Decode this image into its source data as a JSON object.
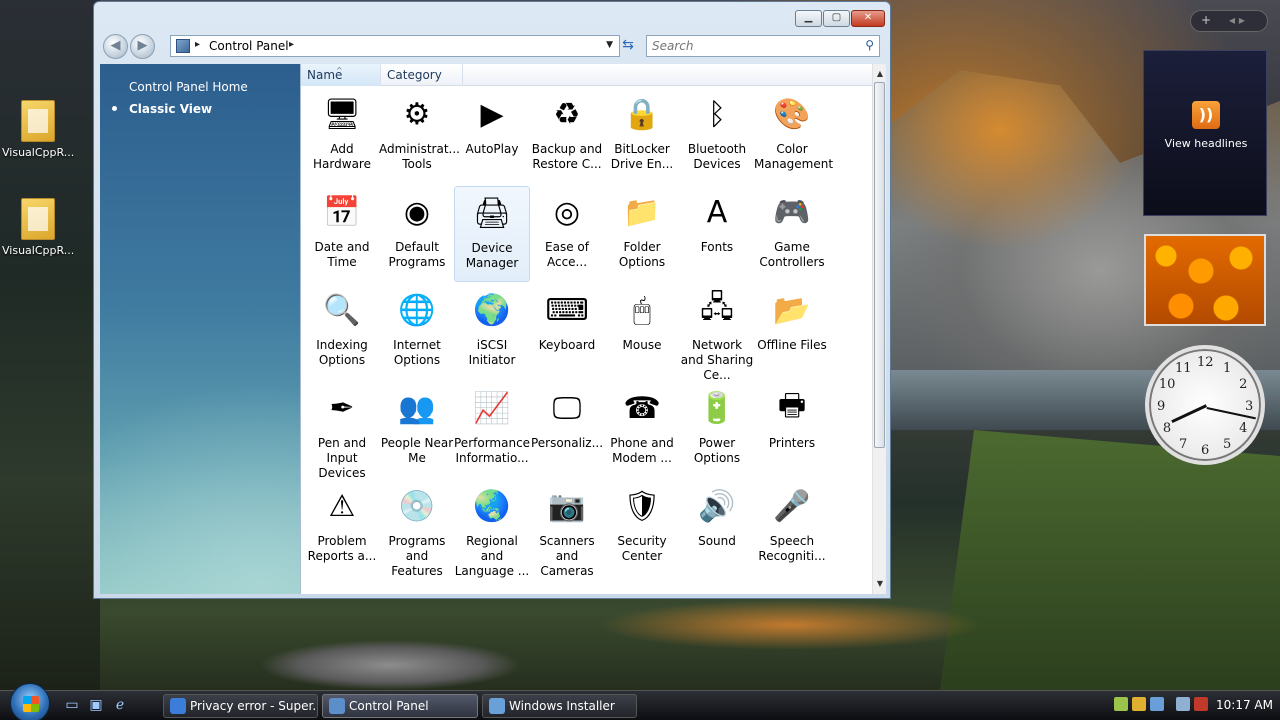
{
  "desktop": {
    "icons": [
      {
        "label": "VisualCppR..."
      },
      {
        "label": "VisualCppR..."
      }
    ]
  },
  "window": {
    "controls": {
      "minimize": "▁",
      "maximize": "▢",
      "close": "✕"
    },
    "address": {
      "path": "Control Panel",
      "separator": "▸"
    },
    "search": {
      "placeholder": "Search"
    },
    "left_pane": {
      "home_link": "Control Panel Home",
      "classic_view": "Classic View"
    },
    "columns": {
      "name": "Name",
      "category": "Category"
    },
    "items": [
      {
        "label": "Add Hardware",
        "icon": "add-hardware-icon",
        "glyph": "🖥"
      },
      {
        "label": "Administrat... Tools",
        "icon": "administrative-tools-icon",
        "glyph": "⚙"
      },
      {
        "label": "AutoPlay",
        "icon": "autoplay-icon",
        "glyph": "▶"
      },
      {
        "label": "Backup and Restore C...",
        "icon": "backup-icon",
        "glyph": "♻"
      },
      {
        "label": "BitLocker Drive En...",
        "icon": "bitlocker-icon",
        "glyph": "🔒"
      },
      {
        "label": "Bluetooth Devices",
        "icon": "bluetooth-icon",
        "glyph": "ᛒ"
      },
      {
        "label": "Color Management",
        "icon": "color-management-icon",
        "glyph": "🎨"
      },
      {
        "label": "Date and Time",
        "icon": "date-time-icon",
        "glyph": "📅"
      },
      {
        "label": "Default Programs",
        "icon": "default-programs-icon",
        "glyph": "◉"
      },
      {
        "label": "Device Manager",
        "icon": "device-manager-icon",
        "glyph": "🖨"
      },
      {
        "label": "Ease of Acce...",
        "icon": "ease-of-access-icon",
        "glyph": "◎"
      },
      {
        "label": "Folder Options",
        "icon": "folder-options-icon",
        "glyph": "📁"
      },
      {
        "label": "Fonts",
        "icon": "fonts-icon",
        "glyph": "A"
      },
      {
        "label": "Game Controllers",
        "icon": "game-controller-icon",
        "glyph": "🎮"
      },
      {
        "label": "Indexing Options",
        "icon": "indexing-icon",
        "glyph": "🔍"
      },
      {
        "label": "Internet Options",
        "icon": "internet-options-icon",
        "glyph": "🌐"
      },
      {
        "label": "iSCSI Initiator",
        "icon": "iscsi-icon",
        "glyph": "🌍"
      },
      {
        "label": "Keyboard",
        "icon": "keyboard-icon",
        "glyph": "⌨"
      },
      {
        "label": "Mouse",
        "icon": "mouse-icon",
        "glyph": "🖱"
      },
      {
        "label": "Network and Sharing Ce...",
        "icon": "network-icon",
        "glyph": "🖧"
      },
      {
        "label": "Offline Files",
        "icon": "offline-files-icon",
        "glyph": "📂"
      },
      {
        "label": "Pen and Input Devices",
        "icon": "pen-icon",
        "glyph": "✒"
      },
      {
        "label": "People Near Me",
        "icon": "people-icon",
        "glyph": "👥"
      },
      {
        "label": "Performance Informatio...",
        "icon": "performance-icon",
        "glyph": "📈"
      },
      {
        "label": "Personaliz...",
        "icon": "personalize-icon",
        "glyph": "🖵"
      },
      {
        "label": "Phone and Modem ...",
        "icon": "phone-icon",
        "glyph": "☎"
      },
      {
        "label": "Power Options",
        "icon": "power-icon",
        "glyph": "🔋"
      },
      {
        "label": "Printers",
        "icon": "printers-icon",
        "glyph": "🖶"
      },
      {
        "label": "Problem Reports a...",
        "icon": "problem-reports-icon",
        "glyph": "⚠"
      },
      {
        "label": "Programs and Features",
        "icon": "programs-icon",
        "glyph": "💿"
      },
      {
        "label": "Regional and Language ...",
        "icon": "regional-icon",
        "glyph": "🌏"
      },
      {
        "label": "Scanners and Cameras",
        "icon": "scanner-icon",
        "glyph": "📷"
      },
      {
        "label": "Security Center",
        "icon": "security-icon",
        "glyph": "🛡"
      },
      {
        "label": "Sound",
        "icon": "sound-icon",
        "glyph": "🔊"
      },
      {
        "label": "Speech Recogniti...",
        "icon": "microphone-icon",
        "glyph": "🎤"
      }
    ]
  },
  "gadgets": {
    "toolbar_plus": "+",
    "toolbar_arrows": "◂ ▸",
    "rss_icon": "))",
    "rss_label": "View headlines",
    "clock_numbers": [
      "12",
      "1",
      "2",
      "3",
      "4",
      "5",
      "6",
      "7",
      "8",
      "9",
      "10",
      "11"
    ]
  },
  "taskbar": {
    "tasks": [
      {
        "label": "Privacy error - Super...",
        "color": "#3b7dd8"
      },
      {
        "label": "Control Panel",
        "color": "#5c8ec9"
      },
      {
        "label": "Windows Installer",
        "color": "#6aa0d8"
      }
    ],
    "time": "10:17 AM"
  }
}
